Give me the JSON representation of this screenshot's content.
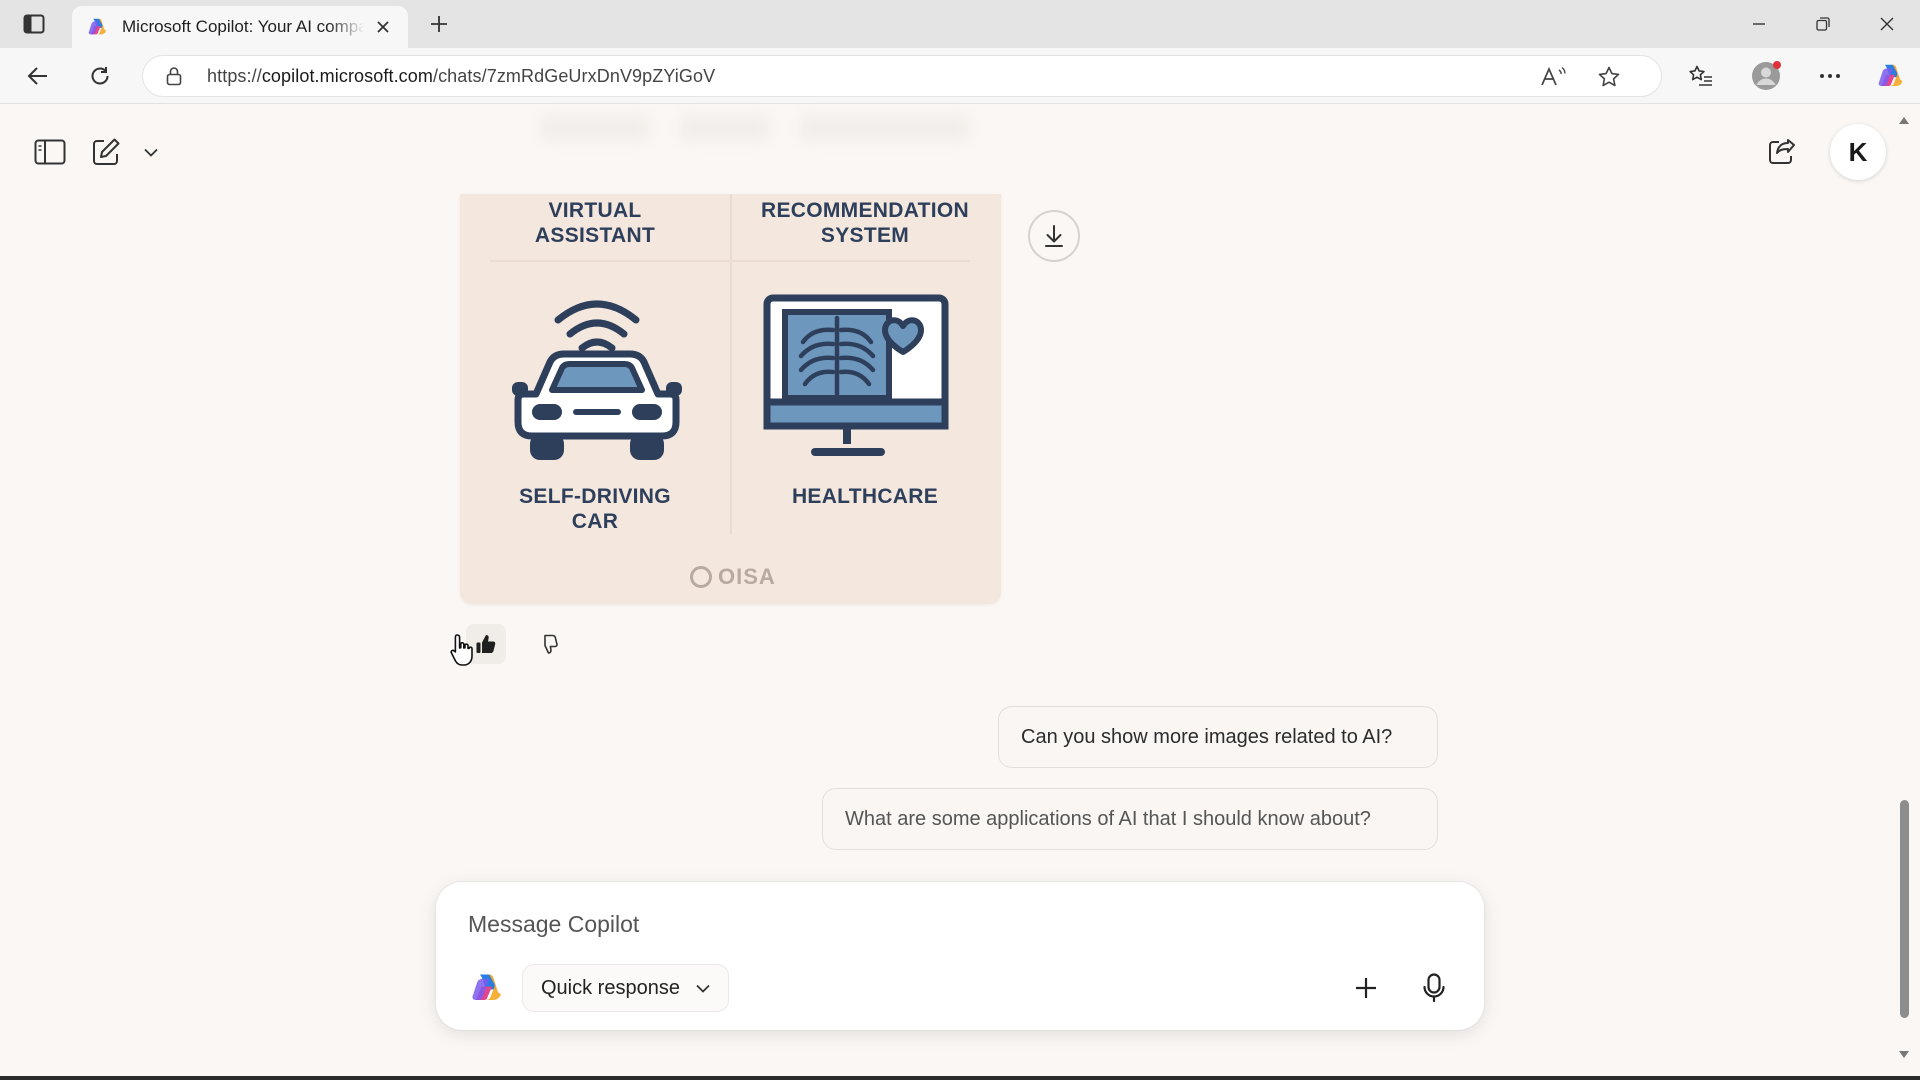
{
  "browser": {
    "tab_title": "Microsoft Copilot: Your AI companion",
    "new_tab_icon": "plus-icon",
    "url_host": "copilot.microsoft.com",
    "url_scheme": "https://",
    "url_path": "/chats/7zmRdGeUrxDnV9pZYiGoV"
  },
  "page": {
    "avatar_initial": "K"
  },
  "image_card": {
    "cells": [
      {
        "label": "VIRTUAL\nASSISTANT",
        "icon": "virtual-assistant"
      },
      {
        "label": "RECOMMENDATION\nSYSTEM",
        "icon": "recommendation-system"
      },
      {
        "label": "SELF-DRIVING\nCAR",
        "icon": "self-driving-car-icon"
      },
      {
        "label": "HEALTHCARE",
        "icon": "healthcare-monitor-icon"
      }
    ],
    "watermark": "OISA"
  },
  "suggestions": [
    "Can you show more images related to AI?",
    "What are some applications of AI that I should know about?"
  ],
  "composer": {
    "placeholder": "Message Copilot",
    "mode": "Quick response"
  },
  "colors": {
    "card_bg": "#f3e7de",
    "art_navy": "#2e3f5c",
    "art_blue": "#6d97bd",
    "page_bg": "#faf7f4"
  }
}
